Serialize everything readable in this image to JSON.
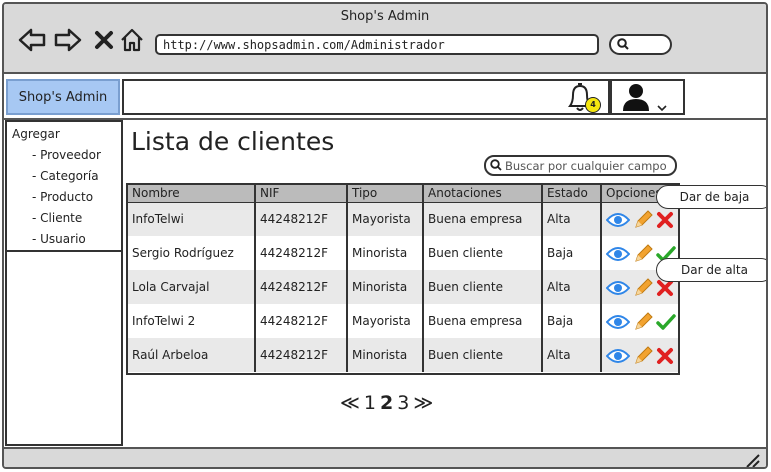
{
  "window": {
    "title": "Shop's Admin"
  },
  "browser": {
    "url": "http://www.shopsadmin.com/Administrador"
  },
  "header": {
    "brand": "Shop's Admin",
    "notification_count": "4"
  },
  "sidebar": {
    "heading": "Agregar",
    "items": [
      {
        "label": "- Proveedor"
      },
      {
        "label": "- Categoría"
      },
      {
        "label": "- Producto"
      },
      {
        "label": "- Cliente"
      },
      {
        "label": "- Usuario"
      }
    ]
  },
  "main": {
    "title": "Lista de clientes",
    "search_placeholder": "Buscar por cualquier campo",
    "columns": [
      "Nombre",
      "NIF",
      "Tipo",
      "Anotaciones",
      "Estado",
      "Opciones"
    ],
    "rows": [
      {
        "nombre": "InfoTelwi",
        "nif": "44248212F",
        "tipo": "Mayorista",
        "anotaciones": "Buena empresa",
        "estado": "Alta",
        "toggle": "baja"
      },
      {
        "nombre": "Sergio Rodríguez",
        "nif": "44248212F",
        "tipo": "Minorista",
        "anotaciones": "Buen cliente",
        "estado": "Baja",
        "toggle": "alta"
      },
      {
        "nombre": "Lola Carvajal",
        "nif": "44248212F",
        "tipo": "Minorista",
        "anotaciones": "Buen cliente",
        "estado": "Alta",
        "toggle": "baja"
      },
      {
        "nombre": "InfoTelwi 2",
        "nif": "44248212F",
        "tipo": "Mayorista",
        "anotaciones": "Buena empresa",
        "estado": "Baja",
        "toggle": "alta"
      },
      {
        "nombre": "Raúl Arbeloa",
        "nif": "44248212F",
        "tipo": "Minorista",
        "anotaciones": "Buen cliente",
        "estado": "Alta",
        "toggle": "baja"
      }
    ]
  },
  "tooltips": {
    "baja": "Dar de baja",
    "alta": "Dar de alta"
  },
  "pagination": {
    "prev": "≪",
    "pages": [
      "1",
      "2",
      "3"
    ],
    "current": "2",
    "next": "≫"
  },
  "colors": {
    "brand_bg": "#a7c8f3",
    "eye": "#2f86e8",
    "pencil": "#f2a330",
    "delete": "#e02020",
    "activate": "#2aa82a",
    "badge": "#f5e60f"
  },
  "icons": {
    "back": "arrow-left-icon",
    "forward": "arrow-right-icon",
    "stop": "close-icon",
    "home": "home-icon",
    "search": "search-icon",
    "bell": "bell-icon",
    "user": "user-icon",
    "view": "eye-icon",
    "edit": "pencil-icon",
    "deactivate": "delete-x-icon",
    "activate": "check-icon"
  }
}
